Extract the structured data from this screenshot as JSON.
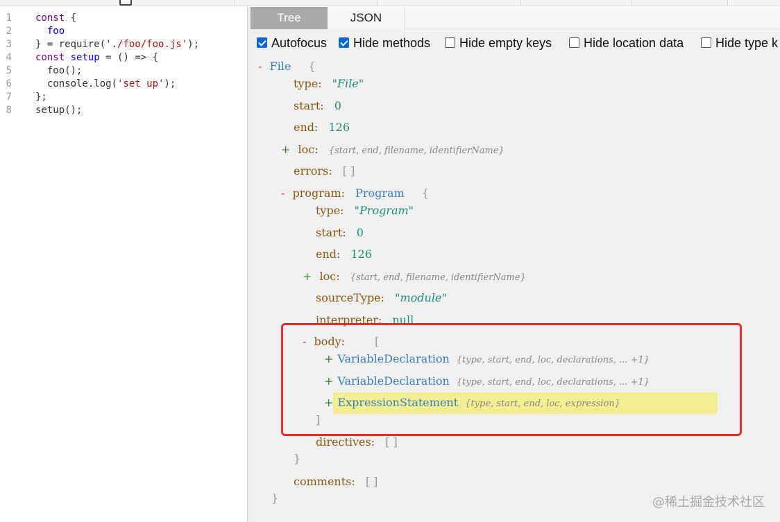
{
  "editor": {
    "lines": [
      {
        "num": "1",
        "parts": [
          {
            "t": "const",
            "c": "kw"
          },
          {
            "t": " {",
            "c": ""
          }
        ]
      },
      {
        "num": "2",
        "parts": [
          {
            "t": "  foo",
            "c": "var"
          }
        ]
      },
      {
        "num": "3",
        "parts": [
          {
            "t": "} = require(",
            "c": ""
          },
          {
            "t": "'./foo/foo.js'",
            "c": "str"
          },
          {
            "t": ");",
            "c": ""
          }
        ]
      },
      {
        "num": "4",
        "parts": [
          {
            "t": "const",
            "c": "kw"
          },
          {
            "t": " ",
            "c": ""
          },
          {
            "t": "setup",
            "c": "var"
          },
          {
            "t": " = () => {",
            "c": ""
          }
        ]
      },
      {
        "num": "5",
        "parts": [
          {
            "t": "  foo();",
            "c": ""
          }
        ]
      },
      {
        "num": "6",
        "parts": [
          {
            "t": "  console.log(",
            "c": ""
          },
          {
            "t": "'set up'",
            "c": "str"
          },
          {
            "t": ");",
            "c": ""
          }
        ]
      },
      {
        "num": "7",
        "parts": [
          {
            "t": "};",
            "c": ""
          }
        ]
      },
      {
        "num": "8",
        "parts": [
          {
            "t": "setup();",
            "c": ""
          }
        ]
      }
    ]
  },
  "tabs": {
    "tree": "Tree",
    "json": "JSON"
  },
  "options": [
    {
      "label": "Autofocus",
      "checked": true
    },
    {
      "label": "Hide methods",
      "checked": true
    },
    {
      "label": "Hide empty keys",
      "checked": false
    },
    {
      "label": "Hide location data",
      "checked": false
    },
    {
      "label": "Hide type k",
      "checked": false
    }
  ],
  "tree": {
    "file": {
      "toggle": "-",
      "type_name": "File",
      "brace": "{"
    },
    "type": {
      "key": "type:",
      "value": "\"File\""
    },
    "start": {
      "key": "start:",
      "value": "0"
    },
    "end": {
      "key": "end:",
      "value": "126"
    },
    "loc": {
      "toggle": "+",
      "key": "loc:",
      "summary": "{start, end, filename, identifierName}"
    },
    "errors": {
      "key": "errors:",
      "value": "[ ]"
    },
    "program": {
      "toggle": "-",
      "key": "program:",
      "type_name": "Program",
      "brace": "{"
    },
    "program_type": {
      "key": "type:",
      "value": "\"Program\""
    },
    "program_start": {
      "key": "start:",
      "value": "0"
    },
    "program_end": {
      "key": "end:",
      "value": "126"
    },
    "program_loc": {
      "toggle": "+",
      "key": "loc:",
      "summary": "{start, end, filename, identifierName}"
    },
    "source_type": {
      "key": "sourceType:",
      "value": "\"module\""
    },
    "interpreter": {
      "key": "interpreter:",
      "value": "null"
    },
    "body": {
      "toggle": "-",
      "key": "body:",
      "brace": "["
    },
    "body_items": [
      {
        "toggle": "+",
        "type_name": "VariableDeclaration",
        "summary": "{type, start, end, loc, declarations, ... +1}"
      },
      {
        "toggle": "+",
        "type_name": "VariableDeclaration",
        "summary": "{type, start, end, loc, declarations, ... +1}"
      },
      {
        "toggle": "+",
        "type_name": "ExpressionStatement",
        "summary": "{type, start, end, loc, expression}"
      }
    ],
    "body_close": "]",
    "directives": {
      "key": "directives:",
      "value": "[ ]"
    },
    "program_close": "}",
    "comments": {
      "key": "comments:",
      "value": "[ ]"
    },
    "file_close": "}"
  },
  "watermark": "@稀土掘金技术社区"
}
